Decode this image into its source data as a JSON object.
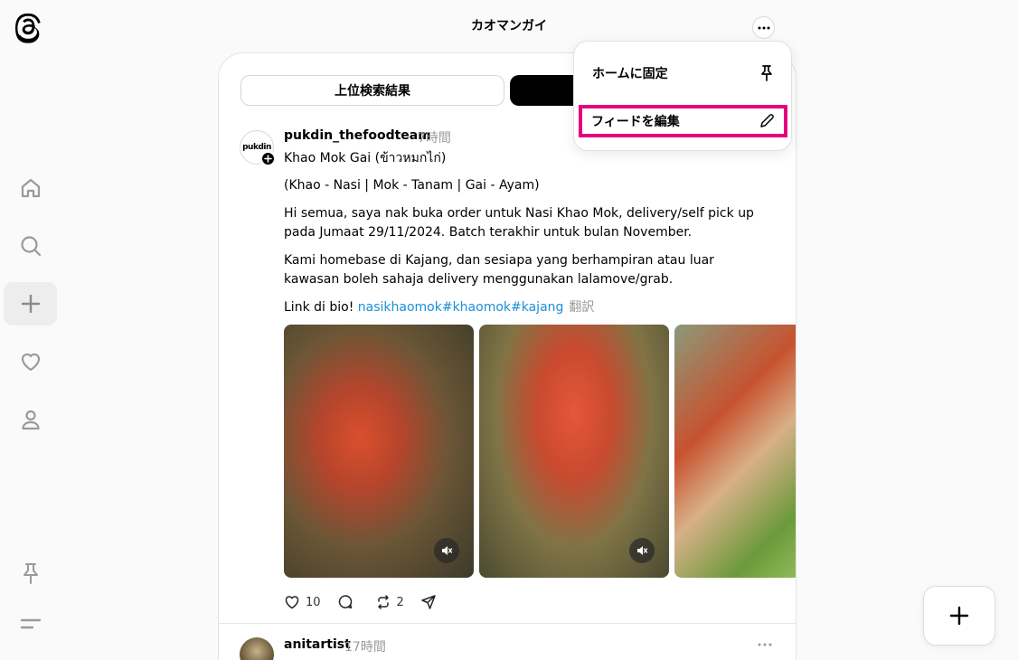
{
  "header": {
    "title": "カオマンガイ"
  },
  "tabs": {
    "top": "上位検索結果",
    "recent": ""
  },
  "menu": {
    "pin_home": "ホームに固定",
    "edit_feed": "フィードを編集"
  },
  "post1": {
    "avatar_text": "pukdin",
    "username": "pukdin_thefoodteam",
    "time": "7時間",
    "line1": "Khao Mok Gai (ข้าวหมกไก่)",
    "line2": "(Khao - Nasi | Mok - Tanam | Gai - Ayam)",
    "line3": "Hi semua, saya nak buka order untuk Nasi Khao Mok, delivery/self pick up pada Jumaat 29/11/2024. Batch terakhir untuk bulan November.",
    "line4": "Kami homebase di Kajang, dan sesiapa yang berhampiran atau luar kawasan boleh sahaja delivery menggunakan lalamove/grab.",
    "link_prefix": "Link di bio! ",
    "hashtags": "nasikhaomok#khaomok#kajang",
    "translate": "翻訳",
    "likes": "10",
    "reposts": "2"
  },
  "post2": {
    "username": "anitartist",
    "time": "17時間"
  },
  "icons": {
    "logo": "threads-logo-icon",
    "home": "home-icon",
    "search": "search-icon",
    "create": "plus-icon",
    "activity": "heart-icon",
    "profile": "person-icon",
    "pin": "pin-icon",
    "menu": "menu-lines-icon",
    "more": "more-icon",
    "edit": "pencil-icon",
    "mute": "mute-icon"
  },
  "colors": {
    "highlight": "#e6007e",
    "hashtag": "#1a8fd6",
    "muted": "#999999"
  }
}
